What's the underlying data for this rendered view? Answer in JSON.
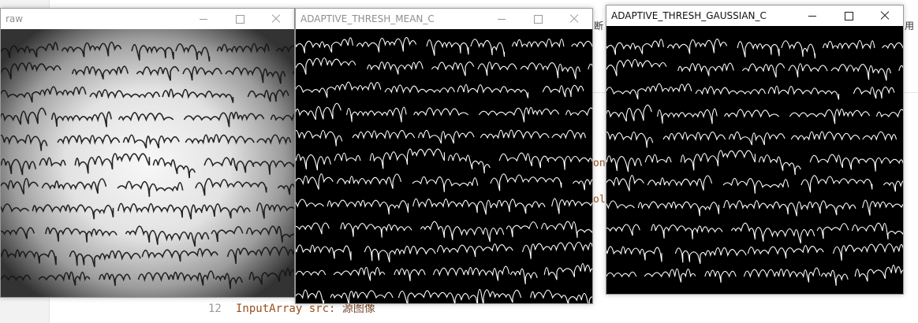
{
  "ide": {
    "line_number": "12",
    "code_type": "InputArray src:",
    "code_comment": "源图像",
    "side_chars": [
      "断",
      "用"
    ],
    "snippets": [
      "on",
      "ol"
    ]
  },
  "windows": {
    "raw": {
      "title": "raw"
    },
    "mean": {
      "title": "ADAPTIVE_THRESH_MEAN_C"
    },
    "gaussian": {
      "title": "ADAPTIVE_THRESH_GAUSSIAN_C"
    }
  },
  "controls": {
    "minimize": "minimize-icon",
    "maximize": "maximize-icon",
    "close": "close-icon"
  },
  "colors": {
    "ink": "#151515",
    "paper_light": "#f4f4f4",
    "paper_dark": "#3a3a3a",
    "thresh_bg": "#000000",
    "thresh_ink": "#ffffff"
  }
}
